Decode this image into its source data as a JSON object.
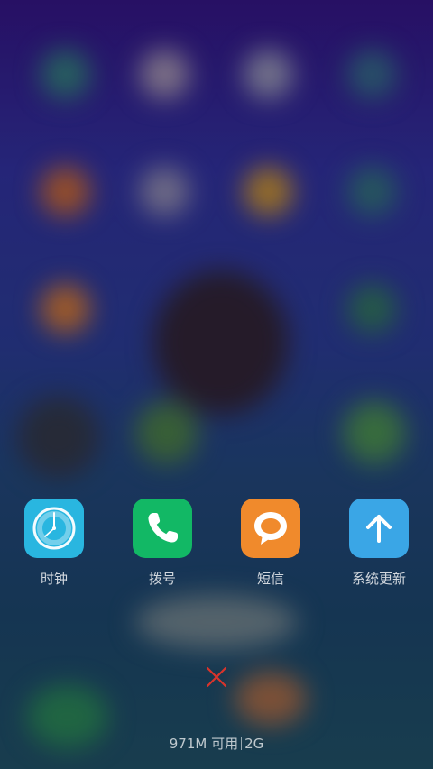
{
  "recent_apps": [
    {
      "label": "时钟",
      "icon": "clock-icon",
      "color": "#29b6e0"
    },
    {
      "label": "拨号",
      "icon": "phone-icon",
      "color": "#12b865"
    },
    {
      "label": "短信",
      "icon": "message-icon",
      "color": "#f08a2c"
    },
    {
      "label": "系统更新",
      "icon": "update-arrow-icon",
      "color": "#3aa6e6"
    }
  ],
  "close_all": {
    "icon": "close-icon",
    "color": "#d9342b"
  },
  "memory": {
    "available": "971M 可用",
    "total": "2G"
  }
}
